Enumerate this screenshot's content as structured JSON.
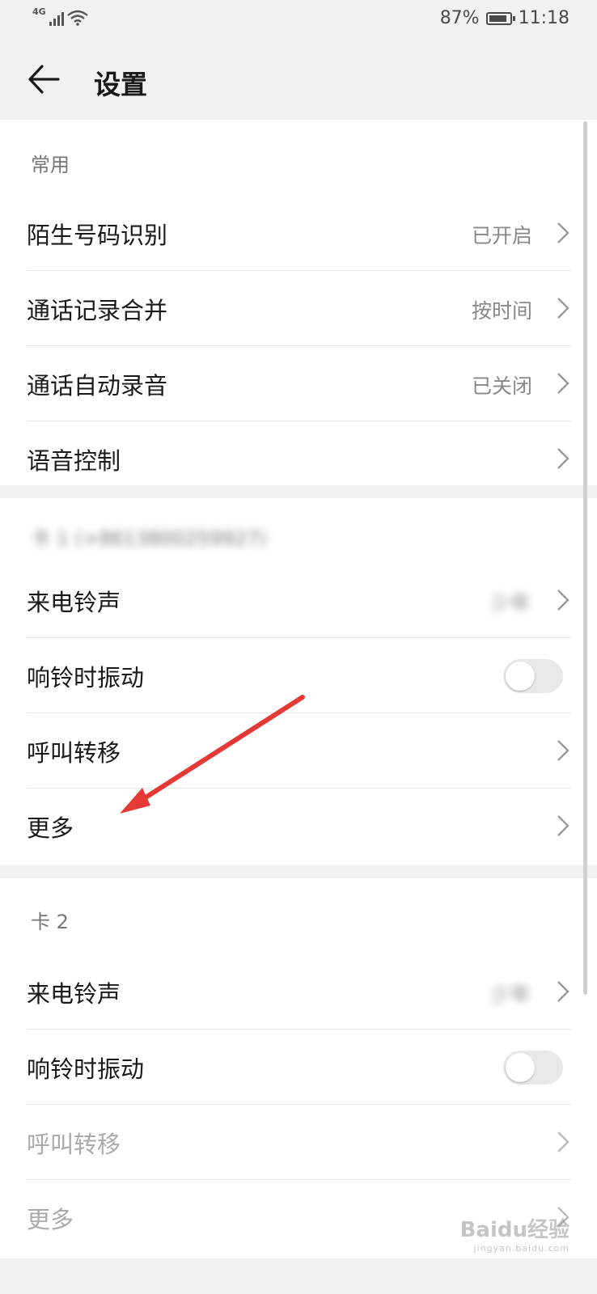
{
  "status_bar": {
    "network": "4G",
    "battery": "87%",
    "battery_level": 0.87,
    "time": "11:18"
  },
  "header": {
    "title": "设置"
  },
  "sections": [
    {
      "label": "常用",
      "rows": [
        {
          "label": "陌生号码识别",
          "value": "已开启"
        },
        {
          "label": "通话记录合并",
          "value": "按时间"
        },
        {
          "label": "通话自动录音",
          "value": "已关闭"
        },
        {
          "label": "语音控制",
          "value": ""
        }
      ]
    },
    {
      "label": "卡 1 (+8613800259927)",
      "rows": [
        {
          "label": "来电铃声",
          "value": "少年"
        },
        {
          "label": "响铃时振动",
          "toggle": false
        },
        {
          "label": "呼叫转移",
          "value": ""
        },
        {
          "label": "更多",
          "value": ""
        }
      ]
    },
    {
      "label": "卡 2",
      "rows": [
        {
          "label": "来电铃声",
          "value": "少年"
        },
        {
          "label": "响铃时振动",
          "toggle": false
        },
        {
          "label": "呼叫转移",
          "value": "",
          "disabled": true
        },
        {
          "label": "更多",
          "value": "",
          "disabled": true
        }
      ]
    }
  ],
  "annotation": {
    "color": "#e53935"
  },
  "watermark": {
    "text": "Baidu经验",
    "sub": "jingyan.baidu.com"
  }
}
